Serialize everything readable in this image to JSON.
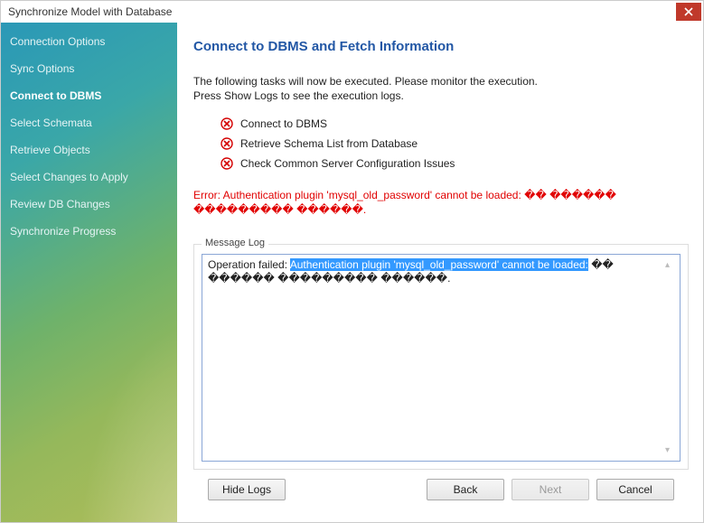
{
  "window": {
    "title": "Synchronize Model with Database"
  },
  "sidebar": {
    "items": [
      {
        "label": "Connection Options",
        "active": false
      },
      {
        "label": "Sync Options",
        "active": false
      },
      {
        "label": "Connect to DBMS",
        "active": true
      },
      {
        "label": "Select Schemata",
        "active": false
      },
      {
        "label": "Retrieve Objects",
        "active": false
      },
      {
        "label": "Select Changes to Apply",
        "active": false
      },
      {
        "label": "Review DB Changes",
        "active": false
      },
      {
        "label": "Synchronize Progress",
        "active": false
      }
    ]
  },
  "page": {
    "heading": "Connect to DBMS and Fetch Information",
    "description_line1": "The following tasks will now be executed. Please monitor the execution.",
    "description_line2": "Press Show Logs to see the execution logs."
  },
  "tasks": [
    {
      "status": "error",
      "label": "Connect to DBMS"
    },
    {
      "status": "error",
      "label": "Retrieve Schema List from Database"
    },
    {
      "status": "error",
      "label": "Check Common Server Configuration Issues"
    }
  ],
  "error_message": "Error: Authentication plugin 'mysql_old_password' cannot be loaded: �� ������ ��������� ������.",
  "log": {
    "group_label": "Message Log",
    "prefix": "Operation failed: ",
    "highlighted": "Authentication plugin 'mysql_old_password' cannot be loaded:",
    "suffix": " �� ������ ��������� ������."
  },
  "buttons": {
    "hide_logs": "Hide Logs",
    "back": "Back",
    "next": "Next",
    "cancel": "Cancel"
  },
  "colors": {
    "accent": "#2257a5",
    "error": "#e10000",
    "highlight_bg": "#3399ff"
  }
}
